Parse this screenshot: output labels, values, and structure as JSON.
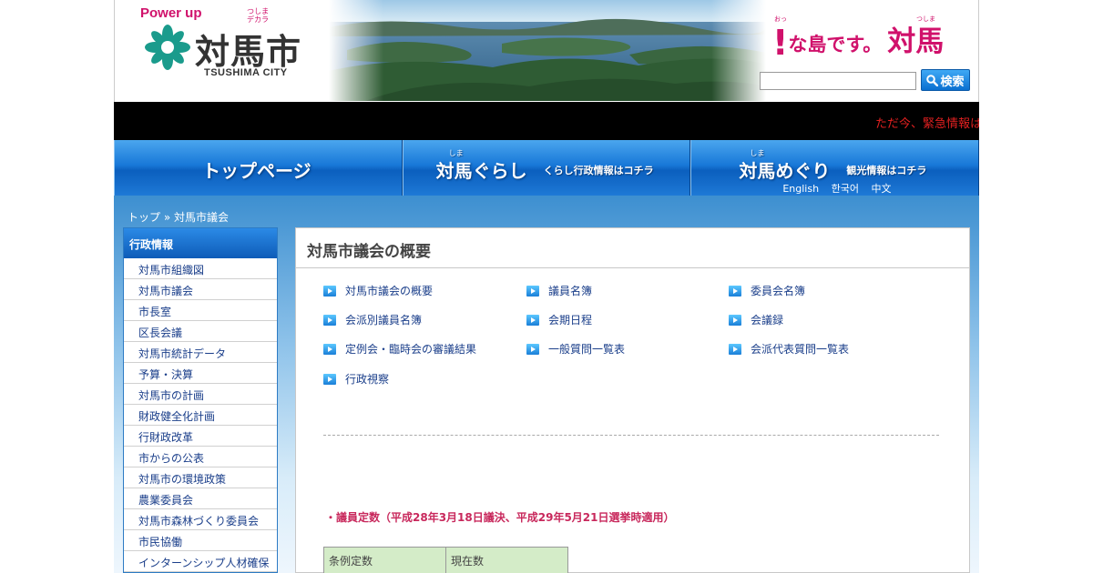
{
  "header": {
    "powerup": "Power up",
    "powerup_sub": "つしまデカラ",
    "city_name": "対馬市",
    "city_en": "TSUSHIMA CITY",
    "slogan_exclaim": "!",
    "slogan_text": "な島です。",
    "slogan_city": "対馬",
    "slogan_ruby_1": "おっ",
    "slogan_ruby_2": "つしま",
    "search_placeholder": "",
    "search_button": "検索"
  },
  "emergency": {
    "text": "ただ今、緊急情報はあ"
  },
  "gnav": {
    "top": "トップページ",
    "kurashi_ruby": "しま",
    "kurashi": "対馬ぐらし",
    "kurashi_sub": "くらし行政情報はコチラ",
    "meguri_ruby": "しま",
    "meguri": "対馬めぐり",
    "meguri_sub": "観光情報はコチラ",
    "lang_en": "English",
    "lang_ko": "한국어",
    "lang_zh": "中文"
  },
  "breadcrumb": {
    "home": "トップ",
    "sep": "»",
    "current": "対馬市議会"
  },
  "sidebar": {
    "heading": "行政情報",
    "items": [
      "対馬市組織図",
      "対馬市議会",
      "市長室",
      "区長会議",
      "対馬市統計データ",
      "予算・決算",
      "対馬市の計画",
      "財政健全化計画",
      "行財政改革",
      "市からの公表",
      "対馬市の環境政策",
      "農業委員会",
      "対馬市森林づくり委員会",
      "市民協働",
      "インターンシップ人材確保"
    ]
  },
  "main": {
    "title": "対馬市議会の概要",
    "links": [
      "対馬市議会の概要",
      "議員名簿",
      "委員会名簿",
      "会派別議員名簿",
      "会期日程",
      "会議録",
      "定例会・臨時会の審議結果",
      "一般質問一覧表",
      "会派代表質問一覧表",
      "行政視察"
    ],
    "note": "・議員定数（平成28年3月18日議決、平成29年5月21日選挙時適用）",
    "table_headers": [
      "条例定数",
      "現在数"
    ]
  },
  "colors": {
    "brand_pink": "#d0116b",
    "nav_blue": "#1878d8",
    "link_blue": "#1a3e8a",
    "note_red": "#c8285c"
  }
}
